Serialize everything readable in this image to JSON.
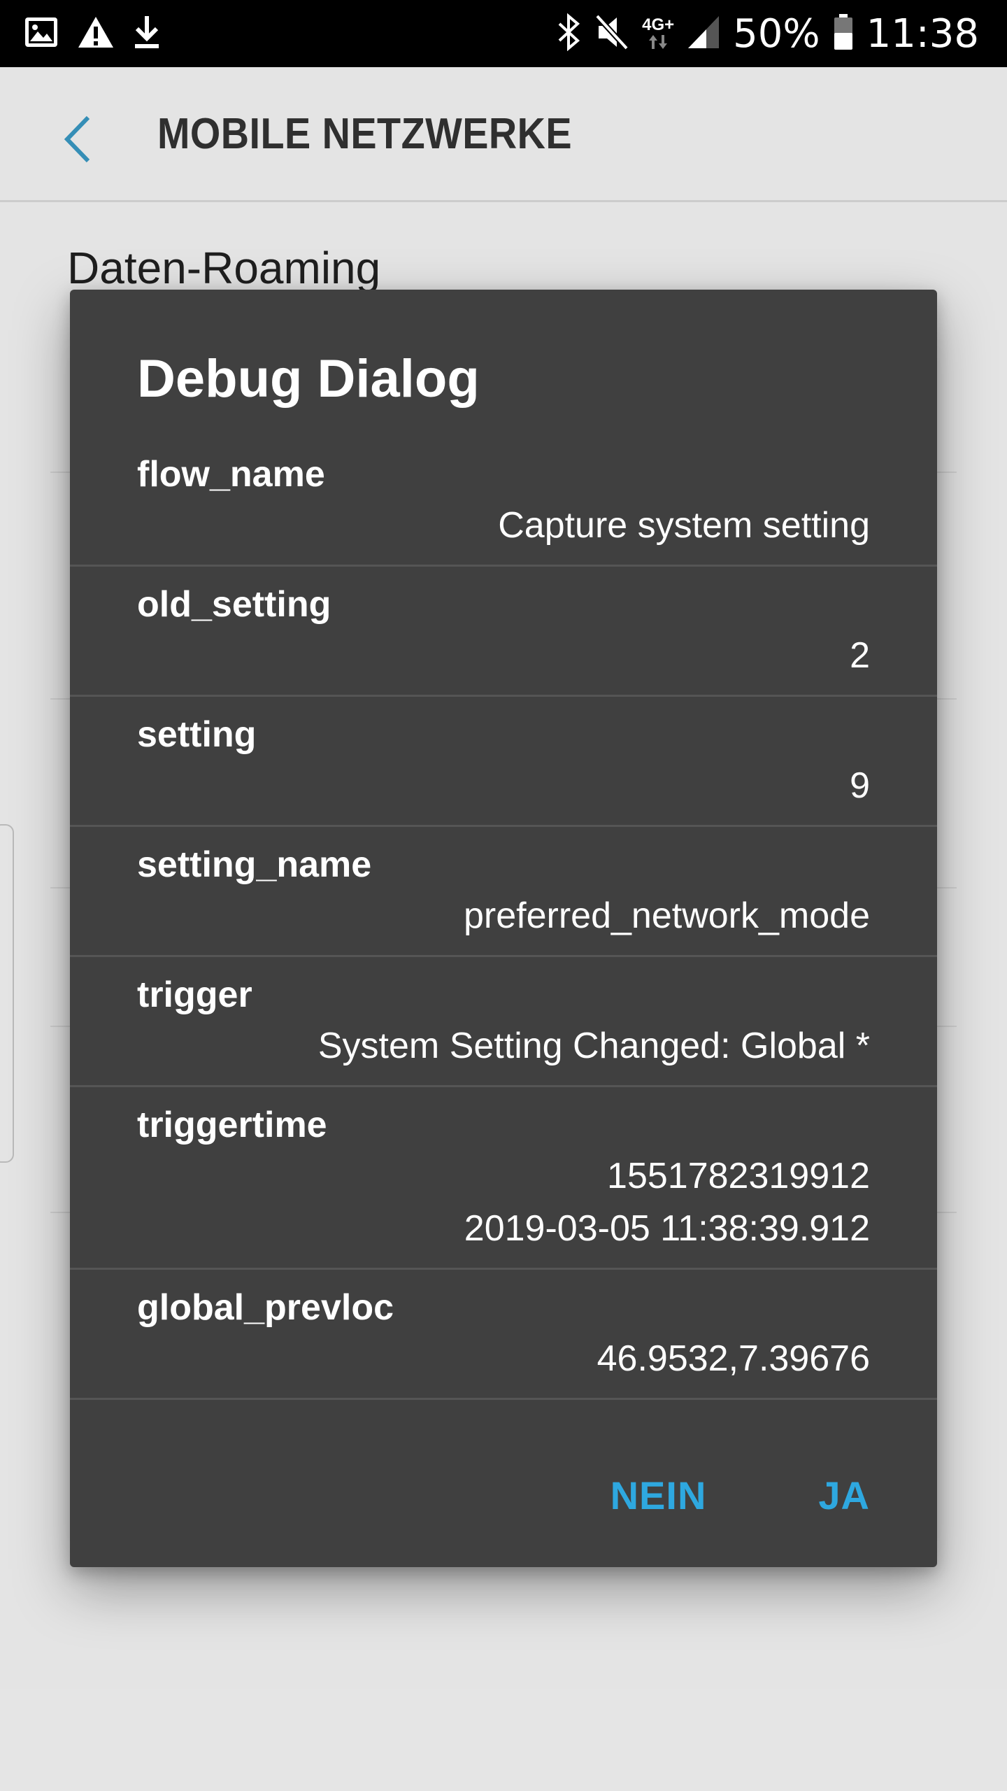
{
  "status_bar": {
    "network_label_top": "4G+",
    "battery_percent": "50%",
    "time": "11:38",
    "icons_left": [
      "image-icon",
      "warning-icon",
      "download-icon"
    ],
    "icons_right": [
      "bluetooth-icon",
      "mute-icon",
      "network-4g-icon",
      "signal-icon",
      "battery-icon"
    ]
  },
  "header": {
    "title": "MOBILE NETZWERKE"
  },
  "background": {
    "first_item_title": "Daten-Roaming"
  },
  "dialog": {
    "title": "Debug Dialog",
    "rows": [
      {
        "key": "flow_name",
        "values": [
          "Capture system setting"
        ]
      },
      {
        "key": "old_setting",
        "values": [
          "2"
        ]
      },
      {
        "key": "setting",
        "values": [
          "9"
        ]
      },
      {
        "key": "setting_name",
        "values": [
          "preferred_network_mode"
        ]
      },
      {
        "key": "trigger",
        "values": [
          "System Setting Changed: Global *"
        ]
      },
      {
        "key": "triggertime",
        "values": [
          "1551782319912",
          "2019-03-05 11:38:39.912"
        ]
      },
      {
        "key": "global_prevloc",
        "values": [
          "46.9532,7.39676"
        ]
      }
    ],
    "buttons": {
      "negative": "NEIN",
      "positive": "JA"
    }
  },
  "colors": {
    "accent": "#2ea8e0",
    "dialog_background": "#404040",
    "page_background": "#f8f8f8"
  }
}
